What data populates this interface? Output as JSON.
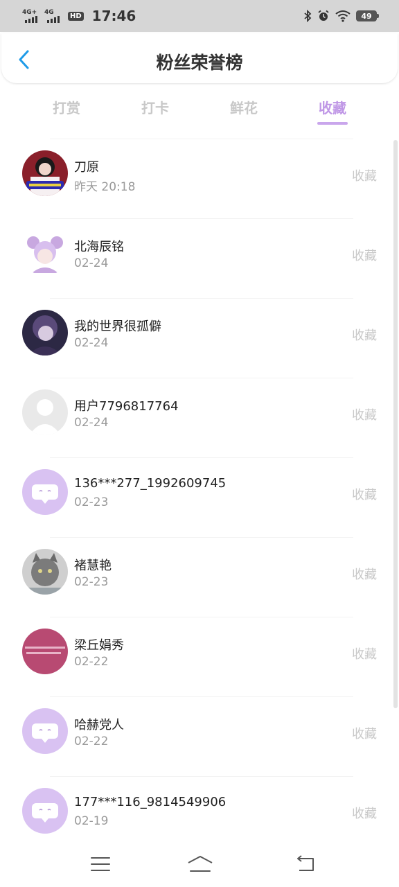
{
  "status_bar": {
    "net1": "4G+",
    "net2": "4G",
    "hd": "HD",
    "time": "17:46",
    "battery": "49"
  },
  "header": {
    "title": "粉丝荣誉榜"
  },
  "tabs": [
    {
      "label": "打赏",
      "active": false
    },
    {
      "label": "打卡",
      "active": false
    },
    {
      "label": "鲜花",
      "active": false
    },
    {
      "label": "收藏",
      "active": true
    }
  ],
  "colors": {
    "accent": "#bf96e6",
    "inactive": "#c8c8c8",
    "back_icon": "#1e9be8"
  },
  "fans": [
    {
      "name": "刀原",
      "time": "昨天 20:18",
      "action": "收藏",
      "avatar": "photo-girl"
    },
    {
      "name": "北海辰铭",
      "time": "02-24",
      "action": "收藏",
      "avatar": "anime-purple"
    },
    {
      "name": "我的世界很孤僻",
      "time": "02-24",
      "action": "收藏",
      "avatar": "anime-dark"
    },
    {
      "name": "用户7796817764",
      "time": "02-24",
      "action": "收藏",
      "avatar": "default-user"
    },
    {
      "name": "136***277_1992609745",
      "time": "02-23",
      "action": "收藏",
      "avatar": "chat-bubble"
    },
    {
      "name": "褚慧艳",
      "time": "02-23",
      "action": "收藏",
      "avatar": "cat-photo"
    },
    {
      "name": "梁丘娟秀",
      "time": "02-22",
      "action": "收藏",
      "avatar": "pink-text"
    },
    {
      "name": "哈赫党人",
      "time": "02-22",
      "action": "收藏",
      "avatar": "chat-bubble"
    },
    {
      "name": "177***116_9814549906",
      "time": "02-19",
      "action": "收藏",
      "avatar": "chat-bubble"
    }
  ],
  "nav_icons": [
    "menu-icon",
    "home-icon",
    "back-nav-icon"
  ]
}
